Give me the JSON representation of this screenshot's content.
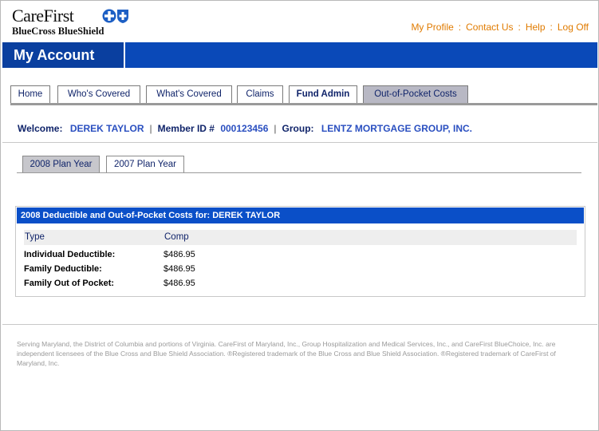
{
  "brand": {
    "logo_line1": "CareFirst",
    "logo_line2": "BlueCross BlueShield"
  },
  "toplinks": {
    "my_profile": "My Profile",
    "contact_us": "Contact Us",
    "help": "Help",
    "log_off": "Log Off",
    "sep": ":",
    "color": "#e07b00"
  },
  "banner": {
    "title": "My Account",
    "color": "#0a49b8"
  },
  "tabs": [
    {
      "label": "Home"
    },
    {
      "label": "Who's Covered"
    },
    {
      "label": "What's Covered"
    },
    {
      "label": "Claims"
    },
    {
      "label": "Fund Admin"
    },
    {
      "label": "Out-of-Pocket Costs"
    }
  ],
  "welcome": {
    "welcome_label": "Welcome:",
    "member_name": "DEREK TAYLOR",
    "member_id_label": "Member ID #",
    "member_id": "000123456",
    "group_label": "Group:",
    "group_name": "LENTZ MORTGAGE GROUP, INC."
  },
  "plan_tabs": [
    {
      "label": "2008 Plan Year"
    },
    {
      "label": "2007 Plan Year"
    }
  ],
  "panel": {
    "header": "2008 Deductible and Out-of-Pocket Costs for: DEREK TAYLOR",
    "col_type": "Type",
    "col_comp": "Comp",
    "rows": [
      {
        "label": "Individual Deductible:",
        "value": "$486.95"
      },
      {
        "label": "Family Deductible:",
        "value": "$486.95"
      },
      {
        "label": "Family Out of Pocket:",
        "value": "$486.95"
      }
    ]
  },
  "footer": {
    "text": "Serving Maryland, the District of Columbia and portions of Virginia. CareFirst of Maryland, Inc., Group Hospitalization and Medical Services, Inc., and CareFirst BlueChoice, Inc. are independent licensees of the Blue Cross and Blue Shield Association. ®Registered trademark of the Blue Cross and Blue Shield Association. ®Registered trademark of CareFirst of Maryland, Inc."
  }
}
